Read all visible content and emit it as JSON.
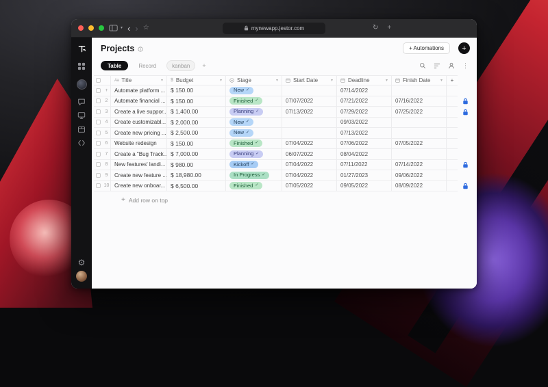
{
  "browser": {
    "url": "mynewapp.jestor.com",
    "titlebar_icons": [
      "sidebar-toggle-icon",
      "chevron-down-icon",
      "back-icon",
      "forward-icon",
      "star-icon",
      "lock-icon",
      "refresh-icon",
      "new-tab-icon"
    ]
  },
  "sidebar": {
    "icons": [
      "jestor-logo",
      "apps-grid-icon",
      "workspace-avatar",
      "chat-icon",
      "monitor-icon",
      "package-icon",
      "code-icon",
      "settings-gear-icon",
      "user-avatar"
    ]
  },
  "header": {
    "title": "Projects",
    "automations_button": "+ Automations",
    "new_button": "+"
  },
  "tabs": [
    {
      "label": "Table",
      "active": true
    },
    {
      "label": "Record",
      "active": false
    },
    {
      "label": "kanban",
      "active": false
    },
    {
      "label": "+",
      "active": false
    }
  ],
  "toolbar_icons": [
    "search-icon",
    "filter-icon",
    "user-icon",
    "more-icon"
  ],
  "table": {
    "headers": [
      {
        "label": "Title",
        "icon": "text-icon"
      },
      {
        "label": "Budget",
        "icon": "currency-icon"
      },
      {
        "label": "Stage",
        "icon": "select-icon"
      },
      {
        "label": "Start Date",
        "icon": "calendar-icon"
      },
      {
        "label": "Deadline",
        "icon": "calendar-icon"
      },
      {
        "label": "Finish Date",
        "icon": "calendar-icon"
      }
    ],
    "add_column_label": "+",
    "stage_colors": {
      "New": {
        "bg": "#b5d6f8",
        "fg": "#23415e"
      },
      "Finished": {
        "bg": "#b9e6c6",
        "fg": "#1d5c38"
      },
      "Planning": {
        "bg": "#c8ccf3",
        "fg": "#383d7c"
      },
      "Kickoff": {
        "bg": "#a6ccf5",
        "fg": "#23415e"
      },
      "In Progress": {
        "bg": "#abdfc4",
        "fg": "#1d5c38"
      }
    },
    "rows": [
      {
        "num": "+",
        "title": "Automate platform ...",
        "budget": "$ 150.00",
        "stage": "New",
        "start": "",
        "deadline": "07/14/2022",
        "finish": "",
        "locked": false
      },
      {
        "num": "2",
        "title": "Automate financial ...",
        "budget": "$ 150.00",
        "stage": "Finished",
        "start": "07/07/2022",
        "deadline": "07/21/2022",
        "finish": "07/16/2022",
        "locked": true
      },
      {
        "num": "3",
        "title": "Create a live suppor...",
        "budget": "$ 1,400.00",
        "stage": "Planning",
        "start": "07/13/2022",
        "deadline": "07/29/2022",
        "finish": "07/25/2022",
        "locked": true
      },
      {
        "num": "4",
        "title": "Create customizabl...",
        "budget": "$ 2,000.00",
        "stage": "New",
        "start": "",
        "deadline": "09/03/2022",
        "finish": "",
        "locked": false
      },
      {
        "num": "5",
        "title": "Create new pricing ...",
        "budget": "$ 2,500.00",
        "stage": "New",
        "start": "",
        "deadline": "07/13/2022",
        "finish": "",
        "locked": false
      },
      {
        "num": "6",
        "title": "Website redesign",
        "budget": "$ 150.00",
        "stage": "Finished",
        "start": "07/04/2022",
        "deadline": "07/06/2022",
        "finish": "07/05/2022",
        "locked": false
      },
      {
        "num": "7",
        "title": "Create a \"Bug Track...",
        "budget": "$ 7,000.00",
        "stage": "Planning",
        "start": "06/07/2022",
        "deadline": "08/04/2022",
        "finish": "",
        "locked": false
      },
      {
        "num": "8",
        "title": "New features' landi...",
        "budget": "$ 980.00",
        "stage": "Kickoff",
        "start": "07/04/2022",
        "deadline": "07/11/2022",
        "finish": "07/14/2022",
        "locked": true
      },
      {
        "num": "9",
        "title": "Create new feature ...",
        "budget": "$ 18,980.00",
        "stage": "In Progress",
        "start": "07/04/2022",
        "deadline": "01/27/2023",
        "finish": "09/06/2022",
        "locked": false
      },
      {
        "num": "10",
        "title": "Create new onboar...",
        "budget": "$ 6,500.00",
        "stage": "Finished",
        "start": "07/05/2022",
        "deadline": "09/05/2022",
        "finish": "08/09/2022",
        "locked": true
      }
    ],
    "add_row_label": "Add row on top"
  }
}
